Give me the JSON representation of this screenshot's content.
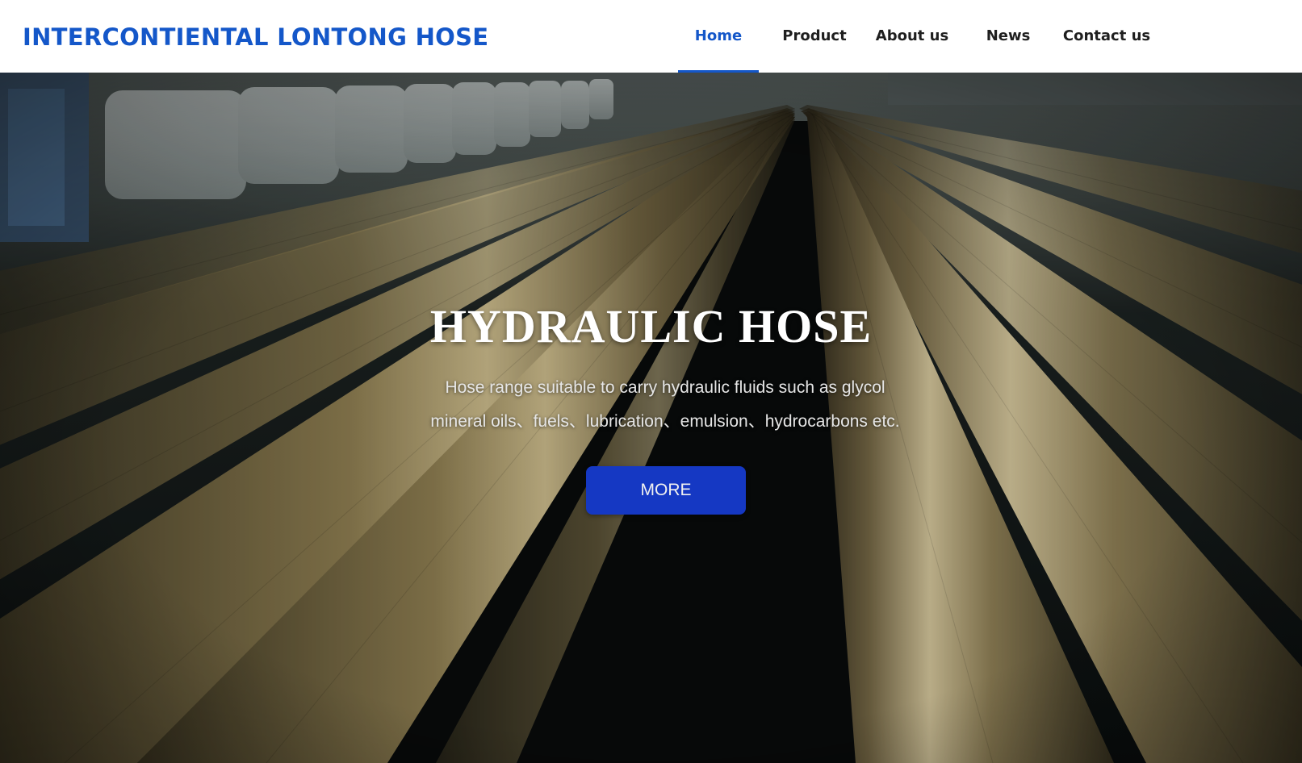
{
  "header": {
    "brand": "INTERCONTIENTAL LONTONG HOSE",
    "nav": [
      {
        "label": "Home",
        "active": true
      },
      {
        "label": "Product",
        "active": false
      },
      {
        "label": "About us",
        "active": false
      },
      {
        "label": "News",
        "active": false
      },
      {
        "label": "Contact us",
        "active": false
      }
    ]
  },
  "hero": {
    "title": "HYDRAULIC HOSE",
    "description_line1": "Hose range suitable to carry hydraulic fluids such as glycol",
    "description_line2": "mineral oils、fuels、lubrication、emulsion、hydrocarbons etc.",
    "button_label": "MORE",
    "background_icon": "industrial-hose-photo"
  },
  "colors": {
    "brand_blue": "#1457c9",
    "button_blue": "#1538c3",
    "nav_text": "#1f1f1f"
  }
}
